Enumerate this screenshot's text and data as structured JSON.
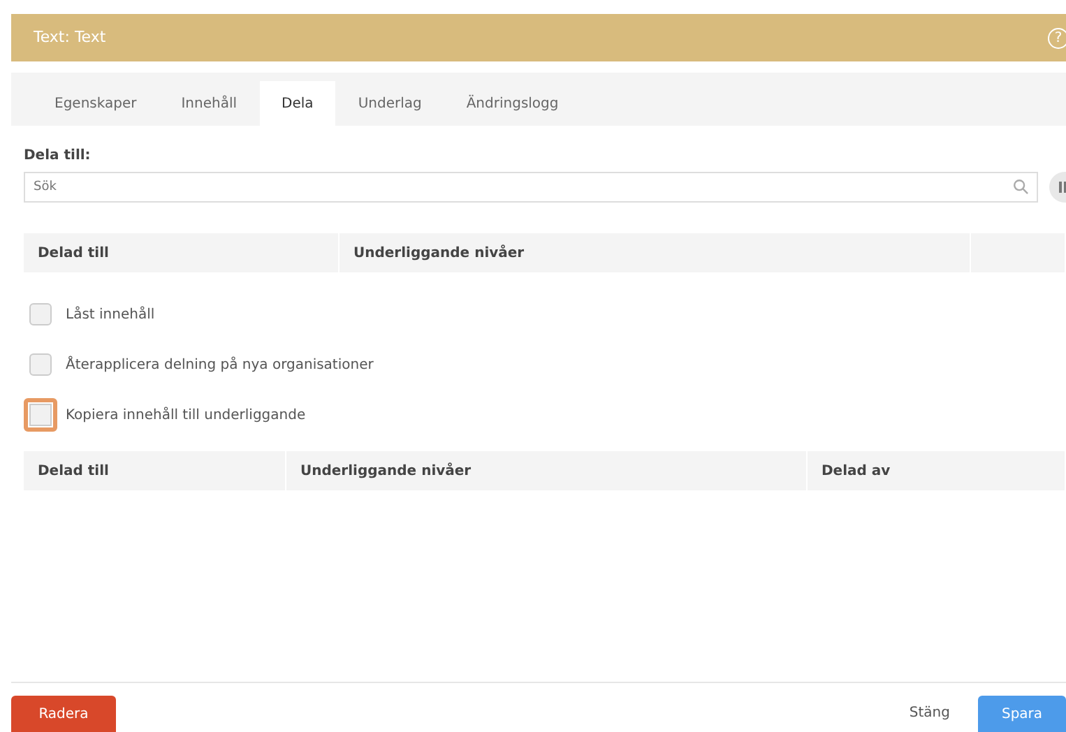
{
  "window": {
    "title": "Text: Text",
    "help_icon": "?"
  },
  "tabs": [
    {
      "label": "Egenskaper",
      "selected": false
    },
    {
      "label": "Innehåll",
      "selected": false
    },
    {
      "label": "Dela",
      "selected": true
    },
    {
      "label": "Underlag",
      "selected": false
    },
    {
      "label": "Ändringslogg",
      "selected": false
    }
  ],
  "share": {
    "label": "Dela till:",
    "search": {
      "placeholder": "Sök"
    }
  },
  "table_1": {
    "columns": [
      "Delad till",
      "Underliggande nivåer",
      ""
    ]
  },
  "options": [
    {
      "label": "Låst innehåll",
      "checked": false,
      "focused": false
    },
    {
      "label": "Återapplicera delning på nya organisationer",
      "checked": false,
      "focused": false
    },
    {
      "label": "Kopiera innehåll till underliggande",
      "checked": false,
      "focused": true
    }
  ],
  "table_2": {
    "columns": [
      "Delad till",
      "Underliggande nivåer",
      "Delad av"
    ]
  },
  "footer": {
    "delete": "Radera",
    "close": "Stäng",
    "save": "Spara"
  }
}
